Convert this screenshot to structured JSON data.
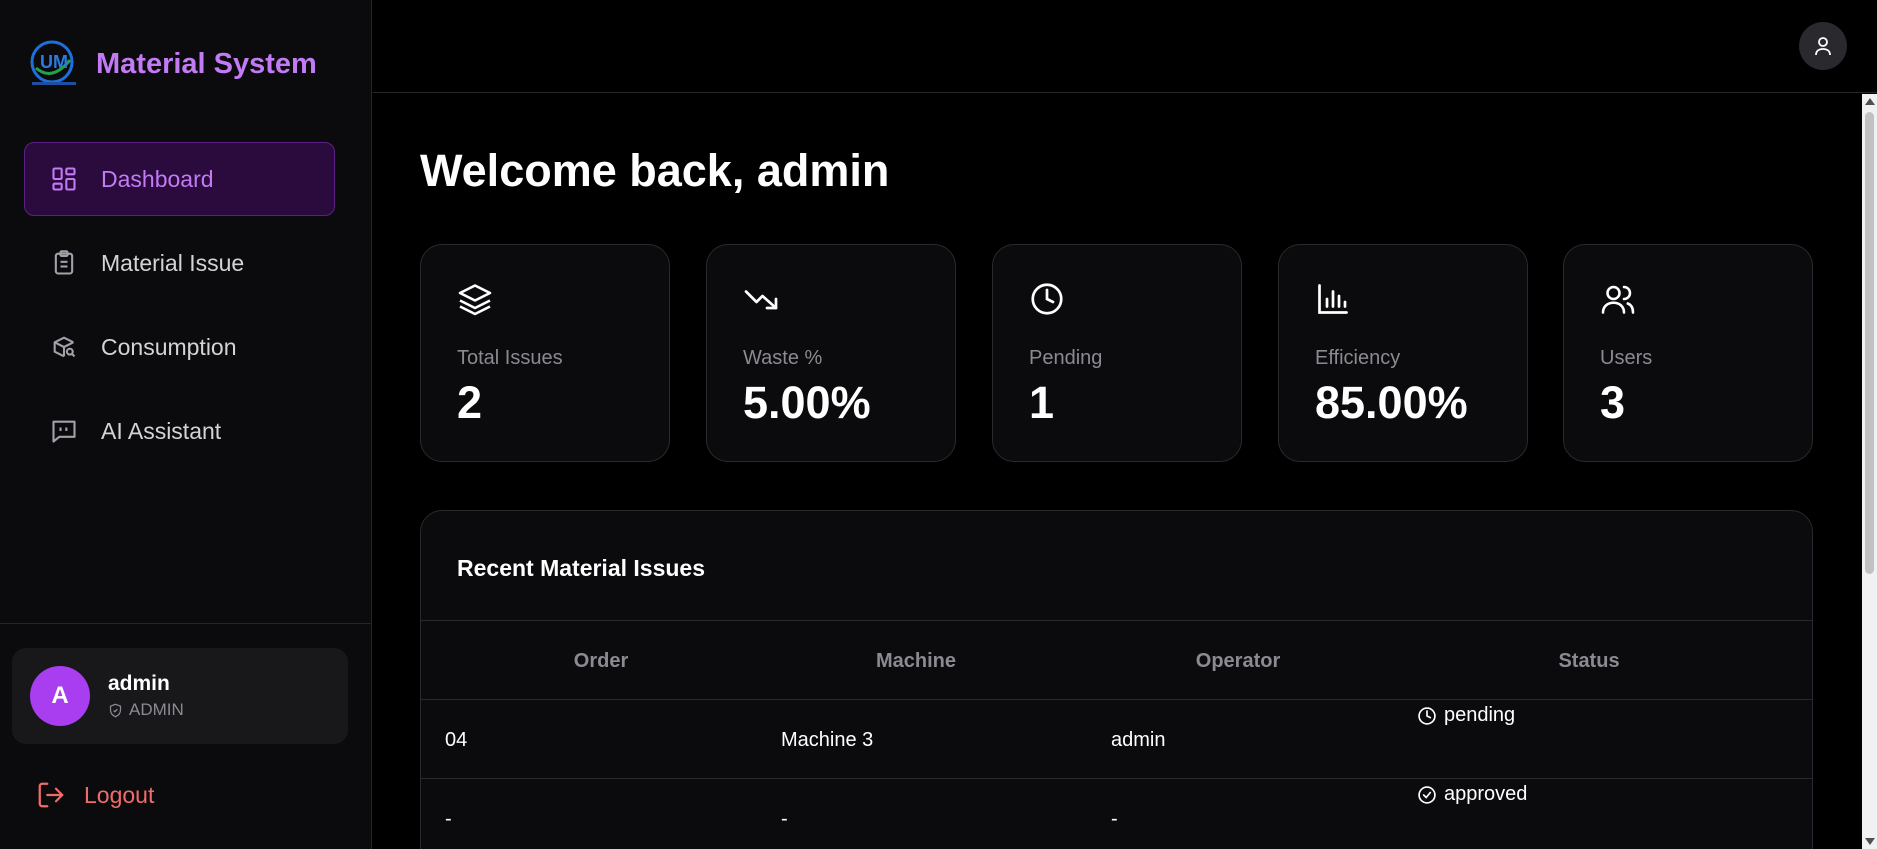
{
  "brand": {
    "title": "Material System",
    "logo_text": "UM"
  },
  "sidebar": {
    "items": [
      {
        "label": "Dashboard",
        "icon": "dashboard-grid-icon",
        "active": true
      },
      {
        "label": "Material Issue",
        "icon": "clipboard-icon",
        "active": false
      },
      {
        "label": "Consumption",
        "icon": "package-search-icon",
        "active": false
      },
      {
        "label": "AI Assistant",
        "icon": "message-quote-icon",
        "active": false
      }
    ]
  },
  "user": {
    "avatar_letter": "A",
    "name": "admin",
    "role": "ADMIN"
  },
  "logout": {
    "label": "Logout"
  },
  "main": {
    "welcome": "Welcome back, admin",
    "stats": [
      {
        "label": "Total Issues",
        "value": "2",
        "icon": "layers-icon"
      },
      {
        "label": "Waste %",
        "value": "5.00%",
        "icon": "trending-down-icon"
      },
      {
        "label": "Pending",
        "value": "1",
        "icon": "clock-icon"
      },
      {
        "label": "Efficiency",
        "value": "85.00%",
        "icon": "bar-chart-icon"
      },
      {
        "label": "Users",
        "value": "3",
        "icon": "users-icon"
      }
    ],
    "recent": {
      "title": "Recent Material Issues",
      "columns": [
        "Order",
        "Machine",
        "Operator",
        "Status"
      ],
      "rows": [
        {
          "order": "04",
          "machine": "Machine 3",
          "operator": "admin",
          "status": "pending",
          "status_icon": "clock-icon"
        },
        {
          "order": "-",
          "machine": "-",
          "operator": "-",
          "status": "approved",
          "status_icon": "check-circle-icon"
        }
      ]
    }
  },
  "colors": {
    "accent": "#c27af5",
    "active_bg": "#2b0b3d",
    "logout": "#f26b6b",
    "avatar": "#a93df0"
  }
}
